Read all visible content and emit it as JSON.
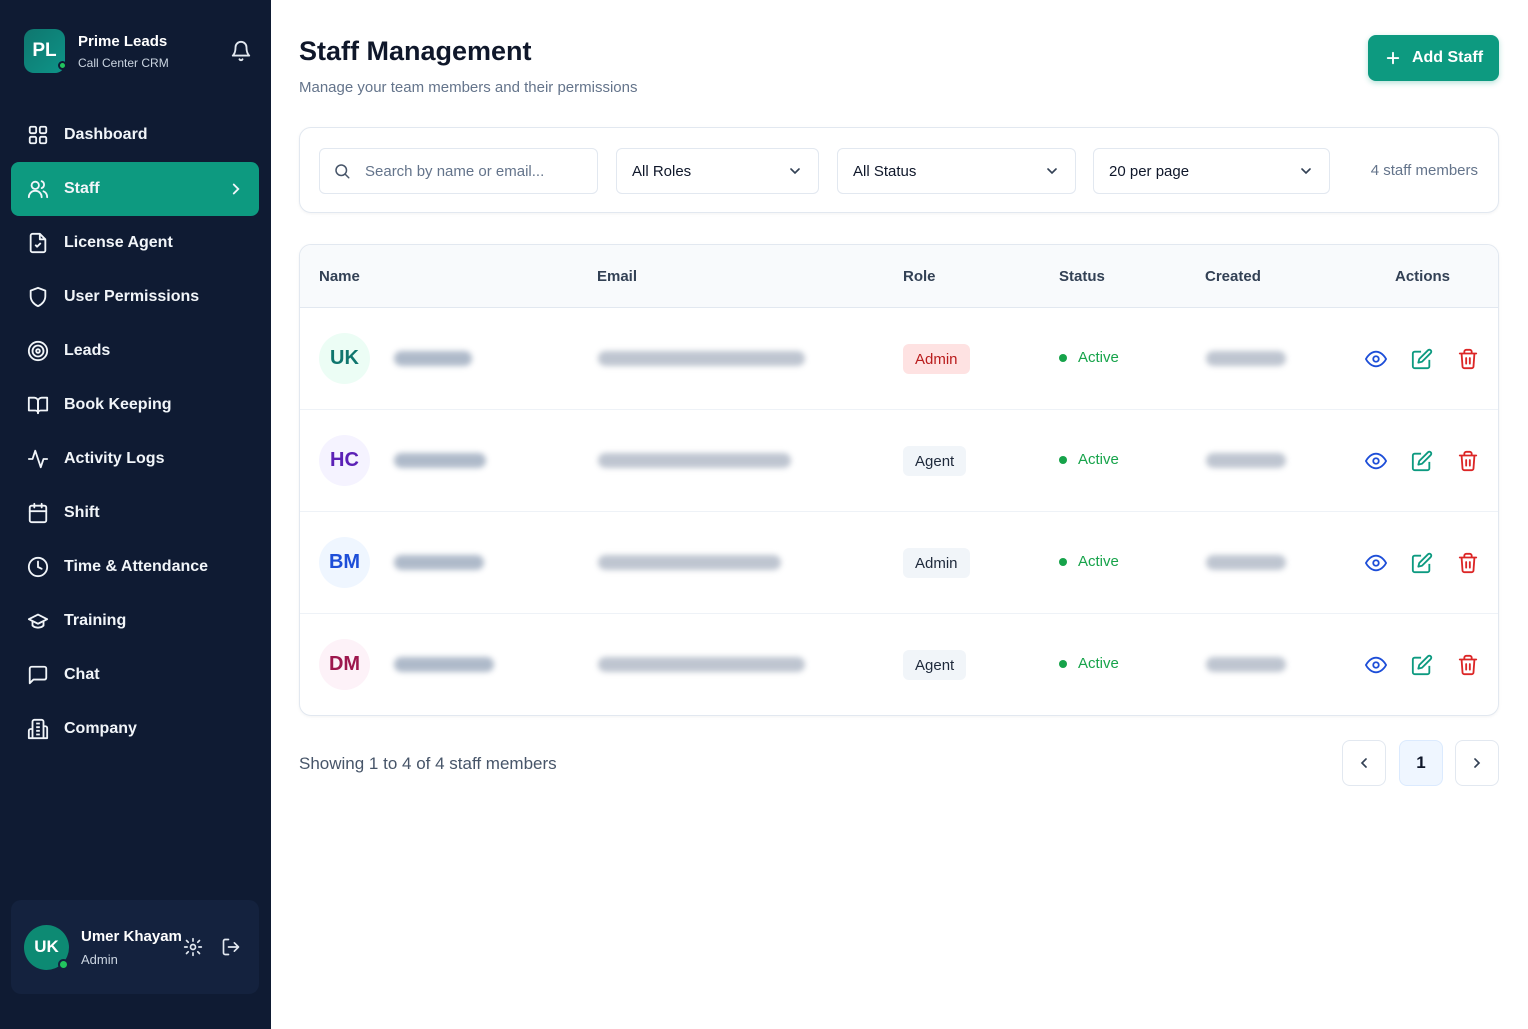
{
  "brand": {
    "logo": "PL",
    "name": "Prime Leads",
    "subtitle": "Call Center CRM"
  },
  "sidebar": {
    "items": [
      {
        "label": "Dashboard",
        "icon": "grid-icon",
        "active": false
      },
      {
        "label": "Staff",
        "icon": "users-icon",
        "active": true
      },
      {
        "label": "License Agent",
        "icon": "file-icon",
        "active": false
      },
      {
        "label": "User Permissions",
        "icon": "shield-icon",
        "active": false
      },
      {
        "label": "Leads",
        "icon": "target-icon",
        "active": false
      },
      {
        "label": "Book Keeping",
        "icon": "book-icon",
        "active": false
      },
      {
        "label": "Activity Logs",
        "icon": "activity-icon",
        "active": false
      },
      {
        "label": "Shift",
        "icon": "calendar-icon",
        "active": false
      },
      {
        "label": "Time & Attendance",
        "icon": "clock-icon",
        "active": false
      },
      {
        "label": "Training",
        "icon": "graduation-cap-icon",
        "active": false
      },
      {
        "label": "Chat",
        "icon": "chat-icon",
        "active": false
      },
      {
        "label": "Company",
        "icon": "building-icon",
        "active": false
      }
    ]
  },
  "user": {
    "initials": "UK",
    "name": "Umer Khayam",
    "role": "Admin"
  },
  "header": {
    "title": "Staff Management",
    "subtitle": "Manage your team members and their permissions",
    "add_label": "Add Staff"
  },
  "filters": {
    "search_placeholder": "Search by name or email...",
    "role_select": "All Roles",
    "status_select": "All Status",
    "per_page_select": "20 per page",
    "count_text": "4 staff members"
  },
  "table": {
    "columns": [
      "Name",
      "Email",
      "Role",
      "Status",
      "Created",
      "Actions"
    ],
    "rows": [
      {
        "initials": "UK",
        "role": "Admin",
        "role_style": "admin-red",
        "status": "Active",
        "avatar_bg": "#ecfdf5",
        "avatar_fg": "#0f766e"
      },
      {
        "initials": "HC",
        "role": "Agent",
        "role_style": "neutral",
        "status": "Active",
        "avatar_bg": "#f5f3ff",
        "avatar_fg": "#5b21b6"
      },
      {
        "initials": "BM",
        "role": "Admin",
        "role_style": "neutral",
        "status": "Active",
        "avatar_bg": "#eff6ff",
        "avatar_fg": "#1d4ed8"
      },
      {
        "initials": "DM",
        "role": "Agent",
        "role_style": "neutral",
        "status": "Active",
        "avatar_bg": "#fdf2f8",
        "avatar_fg": "#9d174d"
      }
    ]
  },
  "pagination": {
    "summary": "Showing 1 to 4 of 4 staff members",
    "current_page": "1"
  },
  "colors": {
    "sidebar_bg": "#0f1b33",
    "accent": "#0d9a80",
    "active_status": "#16a34a",
    "danger": "#dc2626",
    "view": "#1d4ed8"
  }
}
